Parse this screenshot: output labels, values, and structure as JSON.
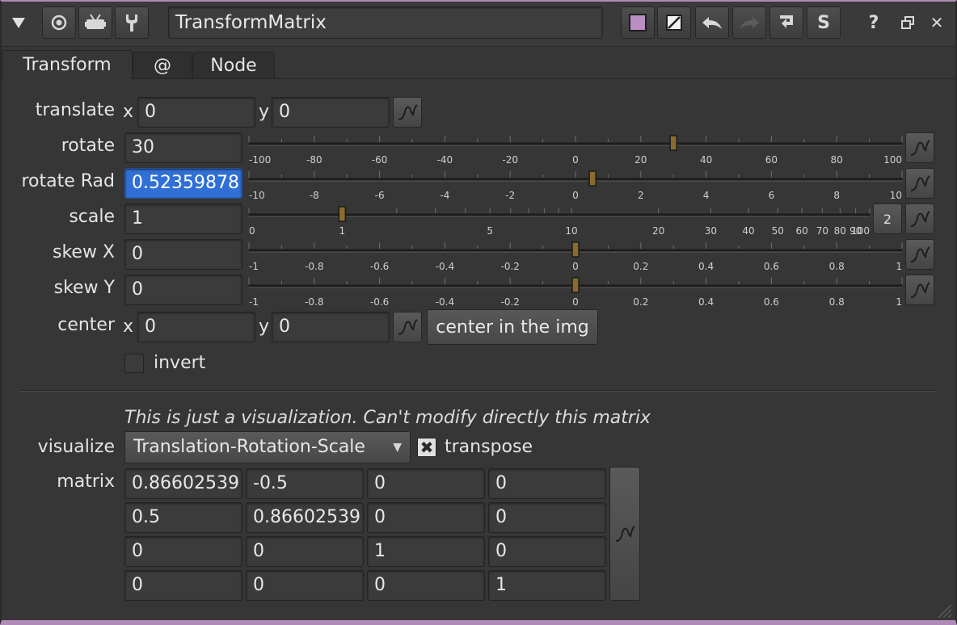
{
  "window": {
    "node_name": "TransformMatrix",
    "collapse_icon": "triangle-down-icon",
    "help_label": "?",
    "restore_icon": "restore-window-icon",
    "close_label": "✕"
  },
  "toolbar": {
    "color1": "#b98fc4",
    "undo_icon": "undo-icon",
    "redo_icon": "redo-icon",
    "reset_icon": "reset-icon",
    "settings_label": "S"
  },
  "tabs": [
    {
      "label": "Transform",
      "active": true
    },
    {
      "label": "@",
      "active": false
    },
    {
      "label": "Node",
      "active": false
    }
  ],
  "params": {
    "translate": {
      "label": "translate",
      "x_label": "x",
      "x": "0",
      "y_label": "y",
      "y": "0"
    },
    "rotate": {
      "label": "rotate",
      "value": "30",
      "ticks": [
        "-100",
        "-80",
        "-60",
        "-40",
        "-20",
        "0",
        "20",
        "40",
        "60",
        "80",
        "100"
      ],
      "slider_value": 30,
      "range": [
        -100,
        100
      ]
    },
    "rotate_rad": {
      "label": "rotate Rad",
      "value": "0.52359878",
      "ticks": [
        "-10",
        "-8",
        "-6",
        "-4",
        "-2",
        "0",
        "2",
        "4",
        "6",
        "8",
        "10"
      ],
      "slider_value": 0.5236,
      "range": [
        -10,
        10
      ]
    },
    "scale": {
      "label": "scale",
      "value": "1",
      "ticks": [
        "0",
        "1",
        "5",
        "10",
        "20",
        "30",
        "40",
        "50",
        "60",
        "70",
        "80",
        "90",
        "100"
      ],
      "dim_button": "2"
    },
    "skew_x": {
      "label": "skew X",
      "value": "0",
      "ticks": [
        "-1",
        "-0.8",
        "-0.6",
        "-0.4",
        "-0.2",
        "0",
        "0.2",
        "0.4",
        "0.6",
        "0.8",
        "1"
      ],
      "slider_value": 0,
      "range": [
        -1,
        1
      ]
    },
    "skew_y": {
      "label": "skew Y",
      "value": "0",
      "ticks": [
        "-1",
        "-0.8",
        "-0.6",
        "-0.4",
        "-0.2",
        "0",
        "0.2",
        "0.4",
        "0.6",
        "0.8",
        "1"
      ],
      "slider_value": 0,
      "range": [
        -1,
        1
      ]
    },
    "center": {
      "label": "center",
      "x_label": "x",
      "x": "0",
      "y_label": "y",
      "y": "0",
      "button": "center in the img"
    },
    "invert": {
      "label": "invert",
      "checked": false
    }
  },
  "visualization": {
    "note": "This is just a visualization. Can't modify directly this matrix",
    "visualize_label": "visualize",
    "mode": "Translation-Rotation-Scale",
    "transpose_label": "transpose",
    "transpose_checked": true,
    "matrix_label": "matrix",
    "matrix": [
      [
        "0.86602539",
        "-0.5",
        "0",
        "0"
      ],
      [
        "0.5",
        "0.86602539",
        "0",
        "0"
      ],
      [
        "0",
        "0",
        "1",
        "0"
      ],
      [
        "0",
        "0",
        "0",
        "1"
      ]
    ]
  }
}
